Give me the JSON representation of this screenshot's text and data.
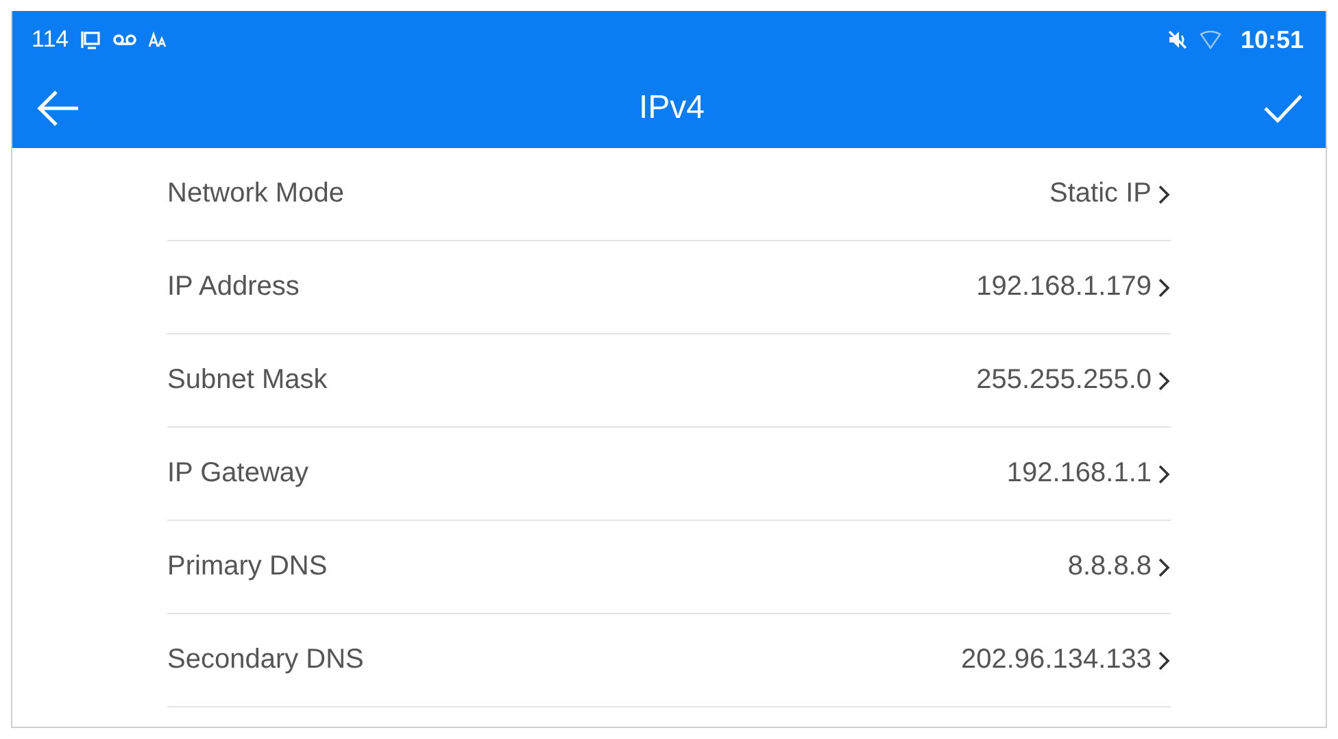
{
  "status_bar": {
    "left_text": "114",
    "time": "10:51"
  },
  "app_bar": {
    "title": "IPv4"
  },
  "settings": [
    {
      "label": "Network Mode",
      "value": "Static IP"
    },
    {
      "label": "IP Address",
      "value": "192.168.1.179"
    },
    {
      "label": "Subnet Mask",
      "value": "255.255.255.0"
    },
    {
      "label": "IP Gateway",
      "value": "192.168.1.1"
    },
    {
      "label": "Primary DNS",
      "value": "8.8.8.8"
    },
    {
      "label": "Secondary DNS",
      "value": "202.96.134.133"
    }
  ]
}
